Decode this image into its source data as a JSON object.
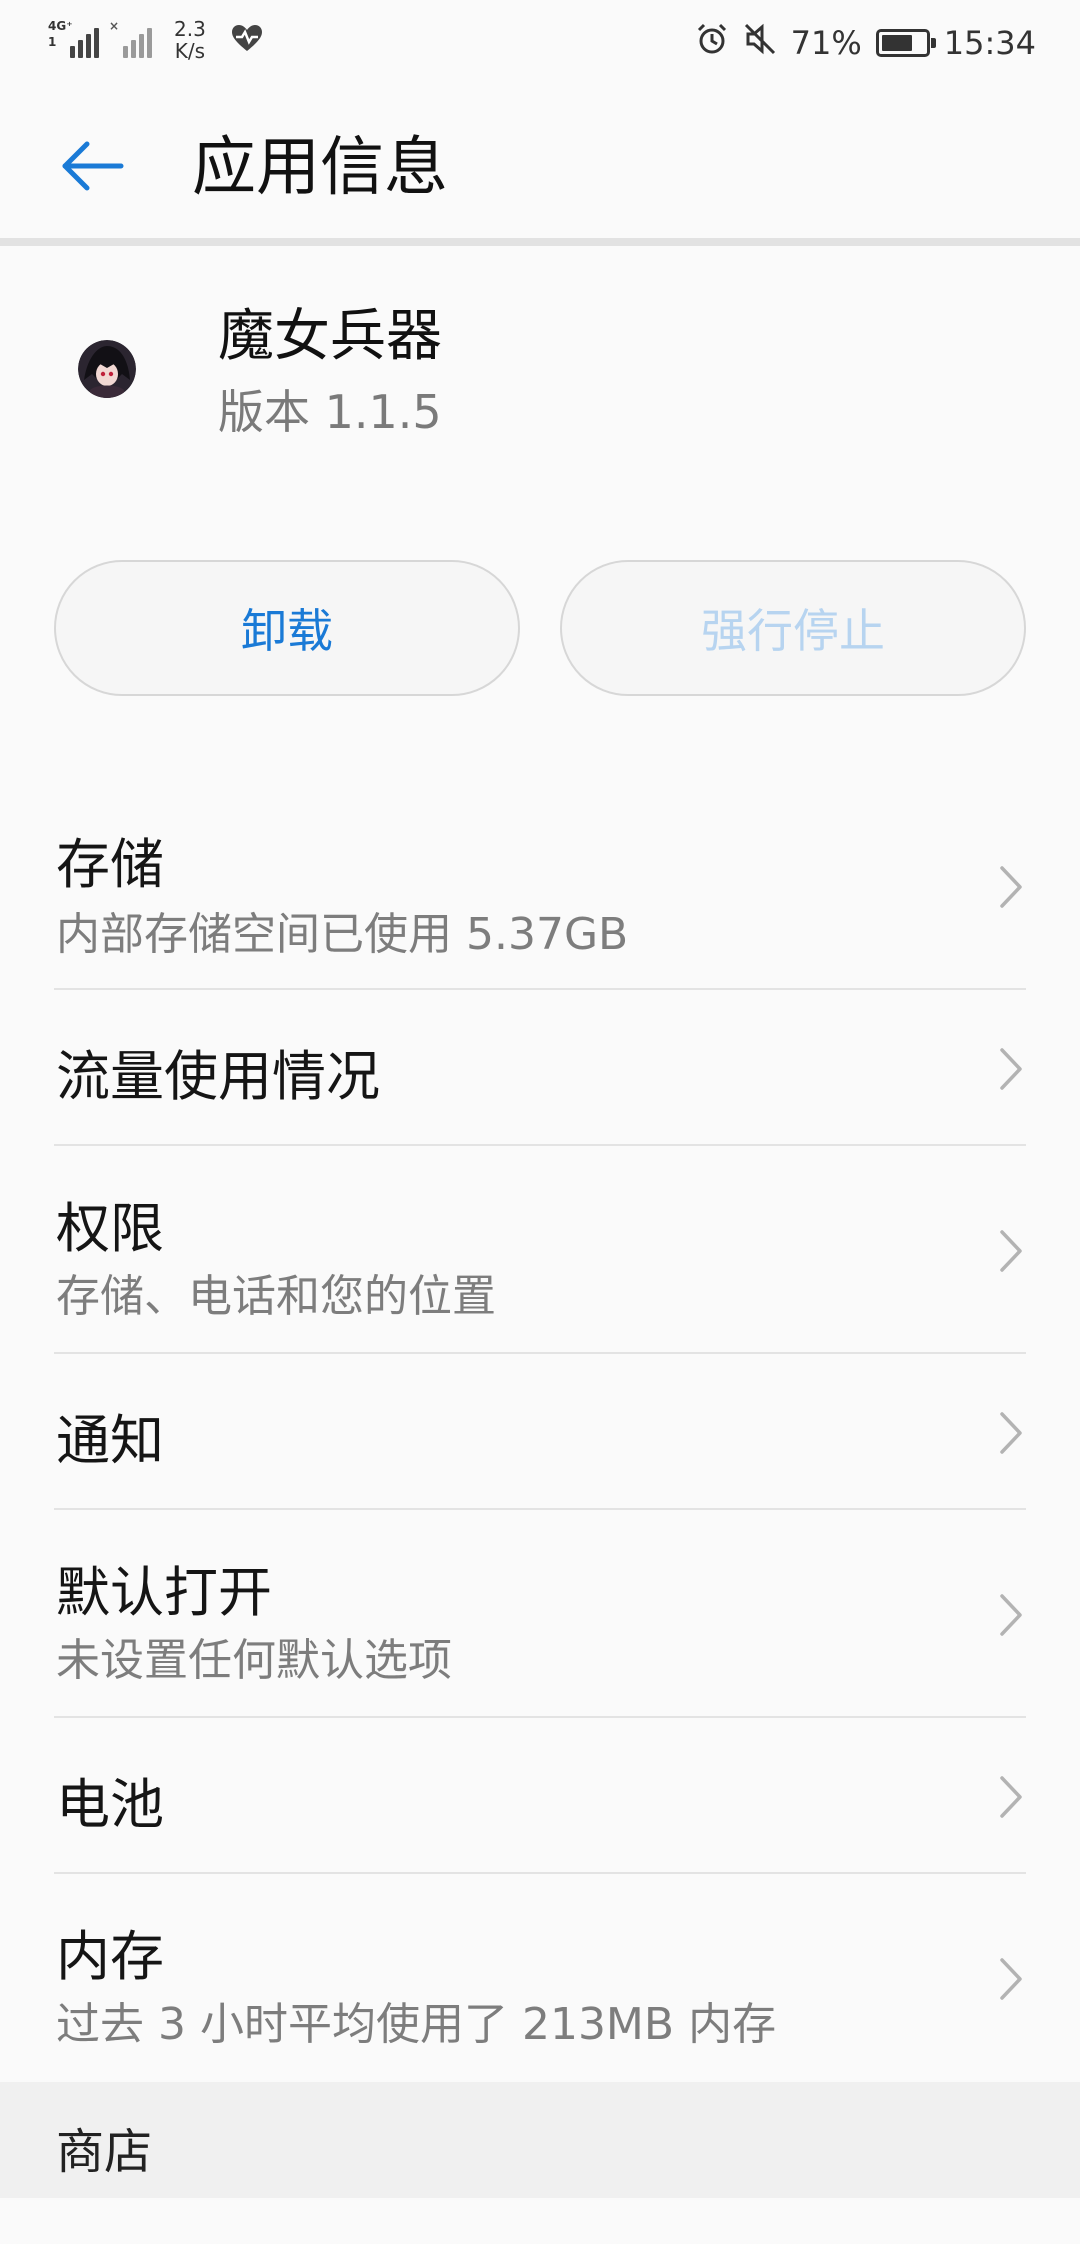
{
  "status_bar": {
    "net_tag": "4G⁺",
    "net_tag2": "1",
    "speed_value": "2.3",
    "speed_unit": "K/s",
    "battery_percent": "71%",
    "battery_level": 0.71,
    "time": "15:34",
    "icons": [
      "signal-icon",
      "no-signal-icon",
      "health-icon",
      "alarm-icon",
      "mute-icon",
      "battery-icon"
    ]
  },
  "header": {
    "title": "应用信息",
    "back_icon": "back-arrow-icon"
  },
  "app": {
    "name": "魔女兵器",
    "version": "版本 1.1.5"
  },
  "buttons": {
    "uninstall": "卸载",
    "force_stop": "强行停止"
  },
  "list": [
    {
      "title": "存储",
      "subtitle": "内部存储空间已使用 5.37GB"
    },
    {
      "title": "流量使用情况",
      "subtitle": ""
    },
    {
      "title": "权限",
      "subtitle": "存储、电话和您的位置"
    },
    {
      "title": "通知",
      "subtitle": ""
    },
    {
      "title": "默认打开",
      "subtitle": "未设置任何默认选项"
    },
    {
      "title": "电池",
      "subtitle": ""
    },
    {
      "title": "内存",
      "subtitle": "过去 3 小时平均使用了 213MB 内存"
    }
  ],
  "section": {
    "store": "商店"
  },
  "colors": {
    "accent": "#1a7ad6",
    "disabled_text": "#b7d4f0",
    "background": "#fafafa"
  }
}
